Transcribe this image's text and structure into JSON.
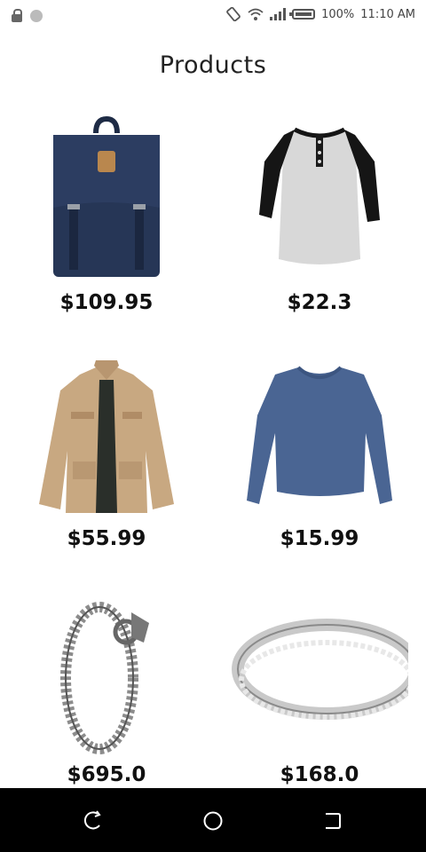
{
  "status_bar": {
    "battery": "100%",
    "time": "11:10 AM"
  },
  "page": {
    "title": "Products"
  },
  "products": [
    {
      "name": "backpack",
      "price": "$109.95"
    },
    {
      "name": "raglan-henley-shirt",
      "price": "$22.3"
    },
    {
      "name": "khaki-jacket",
      "price": "$55.99"
    },
    {
      "name": "blue-long-sleeve-tee",
      "price": "$15.99"
    },
    {
      "name": "dragon-chain-bracelet",
      "price": "$695.0"
    },
    {
      "name": "silver-ring",
      "price": "$168.0"
    }
  ],
  "nav_bar": {
    "icons": [
      "back-icon",
      "home-icon",
      "recents-icon"
    ]
  }
}
